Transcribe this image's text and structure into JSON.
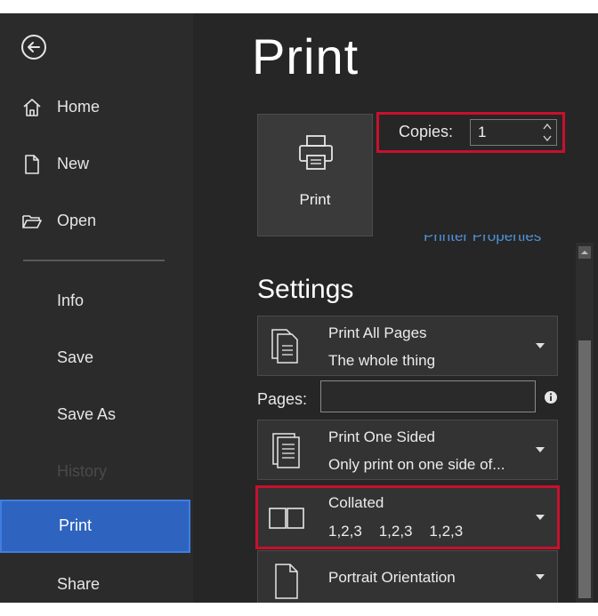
{
  "sidebar": {
    "items": [
      {
        "label": "Home",
        "icon": "home-icon"
      },
      {
        "label": "New",
        "icon": "new-document-icon"
      },
      {
        "label": "Open",
        "icon": "folder-open-icon"
      },
      {
        "label": "Info"
      },
      {
        "label": "Save"
      },
      {
        "label": "Save As"
      },
      {
        "label": "History",
        "state": "disabled"
      },
      {
        "label": "Print",
        "state": "active"
      },
      {
        "label": "Share"
      }
    ]
  },
  "main": {
    "title": "Print",
    "print_button": {
      "label": "Print",
      "icon": "printer-icon"
    },
    "copies": {
      "label": "Copies:",
      "value": "1"
    },
    "printer_properties_link": "Printer Properties",
    "settings_title": "Settings",
    "settings": [
      {
        "line1": "Print All Pages",
        "line2": "The whole thing",
        "icon": "pages-icon"
      },
      {
        "line1": "Print One Sided",
        "line2": "Only print on one side of...",
        "icon": "one-sided-icon"
      },
      {
        "line1": "Collated",
        "line2": "1,2,3    1,2,3    1,2,3",
        "icon": "collated-icon"
      },
      {
        "line1": "Portrait Orientation",
        "line2": "",
        "icon": "portrait-icon"
      }
    ],
    "pages": {
      "label": "Pages:",
      "value": ""
    }
  },
  "colors": {
    "background": "#262626",
    "sidebar": "#2b2b2b",
    "active": "#2e63c0",
    "highlight_border": "#c8102e",
    "link": "#4f8fd6"
  }
}
